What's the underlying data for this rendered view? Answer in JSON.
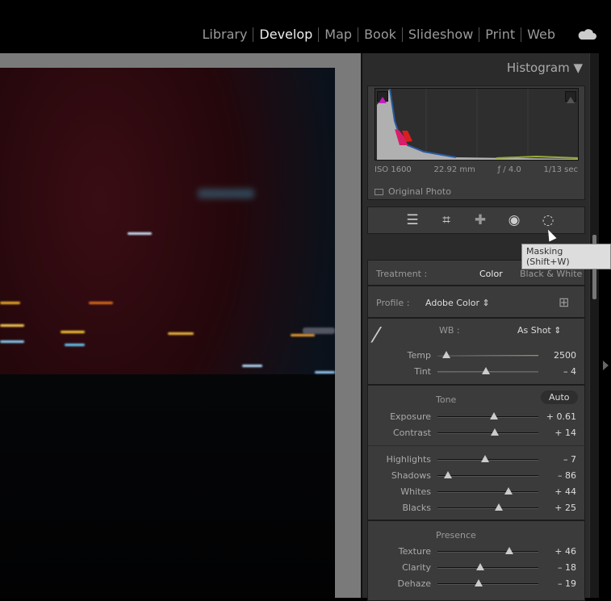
{
  "modules": [
    "Library",
    "Develop",
    "Map",
    "Book",
    "Slideshow",
    "Print",
    "Web"
  ],
  "active_module": "Develop",
  "histogram": {
    "title": "Histogram",
    "iso": "ISO 1600",
    "focal": "22.92 mm",
    "aperture": "ƒ / 4.0",
    "shutter": "1/13 sec",
    "original_photo": "Original Photo"
  },
  "tooltip": "Masking (Shift+W)",
  "basic": {
    "treatment_label": "Treatment :",
    "treatment_color": "Color",
    "treatment_bw": "Black & White",
    "profile_label": "Profile :",
    "profile_value": "Adobe Color ⇕",
    "wb_label": "WB :",
    "wb_value": "As Shot ⇕",
    "tone_label": "Tone",
    "auto": "Auto",
    "presence_label": "Presence",
    "wb_sliders": [
      {
        "name": "Temp",
        "value": "2500",
        "pos": 0.09
      },
      {
        "name": "Tint",
        "value": "– 4",
        "pos": 0.48
      }
    ],
    "tone1": [
      {
        "name": "Exposure",
        "value": "+ 0.61",
        "pos": 0.56
      },
      {
        "name": "Contrast",
        "value": "+ 14",
        "pos": 0.57
      }
    ],
    "tone2": [
      {
        "name": "Highlights",
        "value": "– 7",
        "pos": 0.47
      },
      {
        "name": "Shadows",
        "value": "– 86",
        "pos": 0.1
      },
      {
        "name": "Whites",
        "value": "+ 44",
        "pos": 0.7
      },
      {
        "name": "Blacks",
        "value": "+ 25",
        "pos": 0.61
      }
    ],
    "presence": [
      {
        "name": "Texture",
        "value": "+ 46",
        "pos": 0.71
      },
      {
        "name": "Clarity",
        "value": "– 18",
        "pos": 0.42
      },
      {
        "name": "Dehaze",
        "value": "– 19",
        "pos": 0.41
      }
    ]
  }
}
